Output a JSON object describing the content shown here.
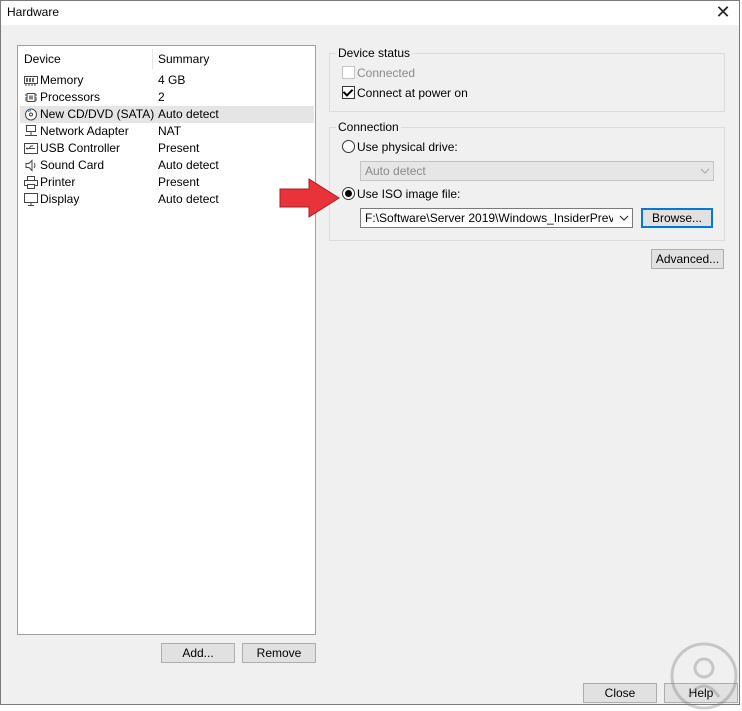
{
  "window": {
    "title": "Hardware"
  },
  "device_list": {
    "headers": {
      "device": "Device",
      "summary": "Summary"
    },
    "items": [
      {
        "icon": "memory-icon",
        "name": "Memory",
        "summary": "4 GB",
        "selected": false
      },
      {
        "icon": "processor-icon",
        "name": "Processors",
        "summary": "2",
        "selected": false
      },
      {
        "icon": "cd-dvd-icon",
        "name": "New CD/DVD (SATA)",
        "summary": "Auto detect",
        "selected": true
      },
      {
        "icon": "network-icon",
        "name": "Network Adapter",
        "summary": "NAT",
        "selected": false
      },
      {
        "icon": "usb-icon",
        "name": "USB Controller",
        "summary": "Present",
        "selected": false
      },
      {
        "icon": "speaker-icon",
        "name": "Sound Card",
        "summary": "Auto detect",
        "selected": false
      },
      {
        "icon": "printer-icon",
        "name": "Printer",
        "summary": "Present",
        "selected": false
      },
      {
        "icon": "monitor-icon",
        "name": "Display",
        "summary": "Auto detect",
        "selected": false
      }
    ],
    "add_label": "Add...",
    "remove_label": "Remove"
  },
  "device_status": {
    "title": "Device status",
    "connected_label": "Connected",
    "connected_checked": false,
    "connected_enabled": false,
    "connect_power_label": "Connect at power on",
    "connect_power_checked": true
  },
  "connection": {
    "title": "Connection",
    "physical_label": "Use physical drive:",
    "physical_selected": false,
    "physical_value": "Auto detect",
    "iso_label": "Use ISO image file:",
    "iso_selected": true,
    "iso_value": "F:\\Software\\Server 2019\\Windows_InsiderPreview_",
    "browse_label": "Browse..."
  },
  "advanced_label": "Advanced...",
  "footer": {
    "close_label": "Close",
    "help_label": "Help"
  },
  "colors": {
    "accent": "#0078d7",
    "arrow": "#e8333a",
    "selected_row": "#e5e5e5"
  }
}
